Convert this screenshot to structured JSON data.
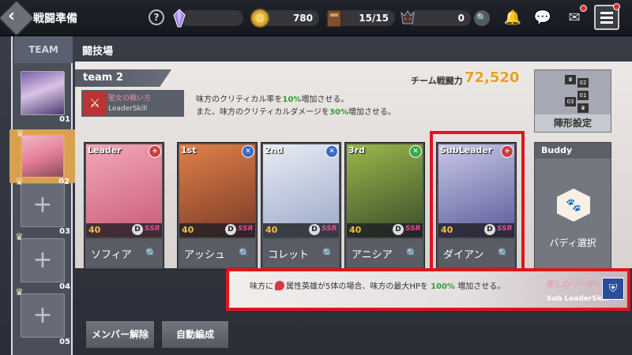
{
  "header": {
    "title": "戦闘準備",
    "help_symbol": "?",
    "coins": "780",
    "stamina": "15/15",
    "monster_count": "0"
  },
  "team_column": {
    "header": "TEAM",
    "slots": [
      {
        "num": "01",
        "state": "filled"
      },
      {
        "num": "02",
        "state": "filled",
        "selected": true
      },
      {
        "num": "03",
        "state": "empty"
      },
      {
        "num": "04",
        "state": "empty"
      },
      {
        "num": "05",
        "state": "empty"
      }
    ],
    "plus_symbol": "+"
  },
  "main": {
    "section_label": "闘技場",
    "team_name": "team 2",
    "power_label": "チーム戦闘力",
    "power_value": "72,520",
    "leader_skill": {
      "name": "聖女の戦い方",
      "tag": "LeaderSkill",
      "line1_prefix": "味方のクリティカル率を",
      "line1_value": "10%",
      "line1_suffix": "増加させる。",
      "line2_prefix": "また、味方のクリティカルダメージを",
      "line2_value": "30%",
      "line2_suffix": "増加させる。"
    },
    "formation": {
      "label": "陣形設定",
      "cells": [
        "02",
        "01",
        "03"
      ]
    },
    "cards": [
      {
        "pos": "Leader",
        "name": "ソフィア",
        "level": "40",
        "grade": "D",
        "rarity": "SSR",
        "class": "+",
        "class_color": "#c84040",
        "art_from": "#f2a8b8",
        "art_to": "#c85a78"
      },
      {
        "pos": "1st",
        "name": "アッシュ",
        "level": "40",
        "grade": "D",
        "rarity": "SSR",
        "class": "✕",
        "class_color": "#3a6ac8",
        "art_from": "#e08048",
        "art_to": "#7a3a28"
      },
      {
        "pos": "2nd",
        "name": "コレット",
        "level": "40",
        "grade": "D",
        "rarity": "SSR",
        "class": "✕",
        "class_color": "#3a6ac8",
        "art_from": "#e8ecf4",
        "art_to": "#9aa8c8"
      },
      {
        "pos": "3rd",
        "name": "アニシア",
        "level": "40",
        "grade": "D",
        "rarity": "SSR",
        "class": "✕",
        "class_color": "#3aa84a",
        "art_from": "#9ab84a",
        "art_to": "#3a4a2a"
      },
      {
        "pos": "SubLeader",
        "name": "ダイアン",
        "level": "40",
        "grade": "D",
        "rarity": "SSR",
        "class": "+",
        "class_color": "#c84040",
        "art_from": "#c8c8e8",
        "art_to": "#5a5a9a"
      }
    ],
    "buddy": {
      "title": "Buddy",
      "label": "バディ選択"
    },
    "sub_leader": {
      "desc_prefix": "味方に",
      "desc_middle": "属性英雄が5体の場合、味方の最大HPを",
      "desc_value": "100%",
      "desc_suffix": "増加させる。",
      "name": "癒しのリーダー",
      "tag": "Sub LeaderSkill"
    }
  },
  "bottom_buttons": {
    "release": "メンバー解除",
    "auto": "自動編成"
  },
  "colors": {
    "accent_gold": "#e6a020",
    "highlight_green": "#3a9a34",
    "outline_red": "#e0141a"
  }
}
